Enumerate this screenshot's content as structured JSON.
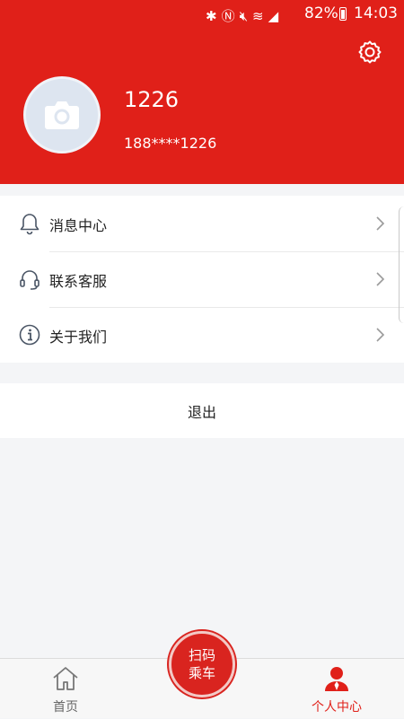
{
  "status_bar": {
    "battery": "82%",
    "time": "14:03"
  },
  "profile": {
    "username": "1226",
    "phone": "188****1226"
  },
  "menu": {
    "items": [
      {
        "label": "消息中心",
        "icon": "bell-icon"
      },
      {
        "label": "联系客服",
        "icon": "headset-icon"
      },
      {
        "label": "关于我们",
        "icon": "info-icon"
      }
    ],
    "logout_label": "退出"
  },
  "tabbar": {
    "home_label": "首页",
    "scan_line1": "扫码",
    "scan_line2": "乘车",
    "profile_label": "个人中心"
  },
  "colors": {
    "brand_red": "#e02019",
    "background": "#f4f5f7"
  }
}
